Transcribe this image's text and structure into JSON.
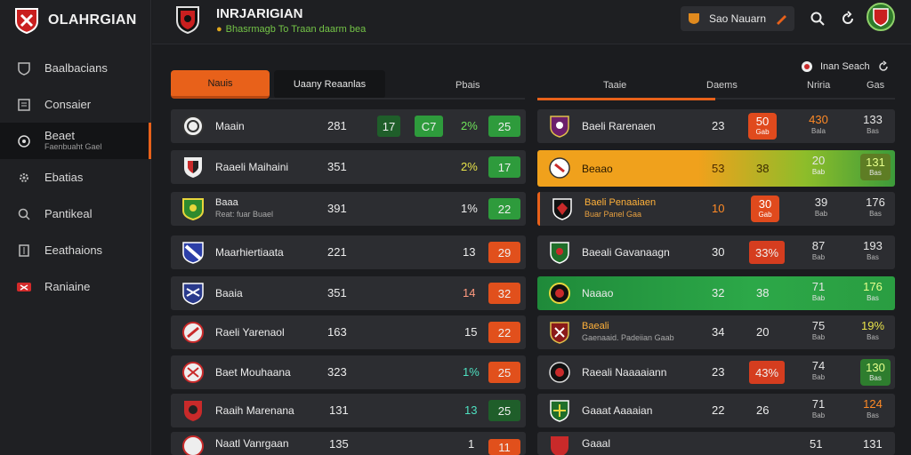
{
  "app": {
    "brand": "OLAHRGIAN",
    "header_title": "INRJARIGIAN",
    "header_subtitle": "Bhasrmagb To Traan daarm bea",
    "user_name": "Sao Nauarn"
  },
  "sidebar": {
    "items": [
      {
        "label": "Baalbacians",
        "sub": "",
        "icon": "shield-icon"
      },
      {
        "label": "Consaier",
        "sub": "",
        "icon": "document-icon"
      },
      {
        "label": "Beaet",
        "sub": "Faenbuaht Gael",
        "icon": "target-icon"
      },
      {
        "label": "Ebatias",
        "sub": "",
        "icon": "gear-icon"
      },
      {
        "label": "Pantikeal",
        "sub": "",
        "icon": "magnify-icon"
      },
      {
        "label": "Eeathaions",
        "sub": "",
        "icon": "list-icon"
      },
      {
        "label": "Raniaine",
        "sub": "",
        "icon": "flag-icon"
      }
    ]
  },
  "tabs": {
    "tab1": "Nauis",
    "tab2": "Uaany Reaanlas",
    "col3": "Pbais"
  },
  "right_headers": {
    "h1": "Taaie",
    "h2": "Daems",
    "h3": "Nriria",
    "h4": "Gas"
  },
  "control": {
    "label": "Inan Seach"
  },
  "left_rows": [
    {
      "name": "Maain",
      "sub": "",
      "c1": "281",
      "c2": "17",
      "c3": "C7",
      "c4": "2%",
      "c5": "25"
    },
    {
      "name": "Raaeli Maihaini",
      "sub": "",
      "c1": "351",
      "c4": "2%",
      "c5": "17"
    },
    {
      "name": "Baaa",
      "sub": "Reat: fuar Buael",
      "c1": "391",
      "c4": "1%",
      "c5": "22"
    },
    {
      "name": "Maarhiertiaata",
      "sub": "",
      "c1": "221",
      "c4": "13",
      "c5": "29"
    },
    {
      "name": "Baaia",
      "sub": "",
      "c1": "351",
      "c4": "14",
      "c5": "32"
    },
    {
      "name": "Raeli Yarenaol",
      "sub": "",
      "c1": "163",
      "c4": "15",
      "c5": "22"
    },
    {
      "name": "Baet Mouhaana",
      "sub": "",
      "c1": "323",
      "c4": "1%",
      "c5": "25"
    },
    {
      "name": "Raaih Marenana",
      "sub": "",
      "c1": "131",
      "c4": "13",
      "c5": "25"
    },
    {
      "name": "Naatl Vanrgaan",
      "sub": "",
      "c1": "135",
      "c4": "1",
      "c5": "11"
    }
  ],
  "right_rows": [
    {
      "name": "Baeli Rarenaen",
      "sub": "",
      "a": "23",
      "b": "50",
      "b_sub": "Gab",
      "c": "430",
      "c_sub": "Bala",
      "d": "133",
      "d_sub": "Bas"
    },
    {
      "name": "Beaao",
      "sub": "",
      "a": "53",
      "b": "38",
      "b_sub": "",
      "c": "20",
      "c_sub": "Bab",
      "d": "131",
      "d_sub": "Bas"
    },
    {
      "name": "Baeli Penaaiaen",
      "sub": "Buar Panel Gaa",
      "a": "10",
      "b": "30",
      "b_sub": "Gab",
      "c": "39",
      "c_sub": "Bab",
      "d": "176",
      "d_sub": "Bas"
    },
    {
      "name": "Baeali Gavanaagn",
      "sub": "",
      "a": "30",
      "b": "33%",
      "b_sub": "",
      "c": "87",
      "c_sub": "Bab",
      "d": "193",
      "d_sub": "Bas"
    },
    {
      "name": "Naaao",
      "sub": "",
      "a": "32",
      "b": "38",
      "b_sub": "",
      "c": "71",
      "c_sub": "Bab",
      "d": "176",
      "d_sub": "Bas"
    },
    {
      "name": "Baeali",
      "sub": "Gaenaaid. Padeiian Gaab",
      "a": "34",
      "b": "20",
      "b_sub": "",
      "c": "75",
      "c_sub": "Bab",
      "d": "19%",
      "d_sub": "Bas"
    },
    {
      "name": "Raeali Naaaaiann",
      "sub": "",
      "a": "23",
      "b": "43%",
      "b_sub": "",
      "c": "74",
      "c_sub": "Bab",
      "d": "130",
      "d_sub": "Bas"
    },
    {
      "name": "Gaaat Aaaaian",
      "sub": "",
      "a": "22",
      "b": "26",
      "b_sub": "",
      "c": "71",
      "c_sub": "Bab",
      "d": "124",
      "d_sub": "Bas"
    },
    {
      "name": "Gaaal",
      "sub": "",
      "a": "",
      "b": "",
      "b_sub": "",
      "c": "51",
      "c_sub": "",
      "d": "131",
      "d_sub": ""
    }
  ],
  "colors": {
    "accent": "#e8611a",
    "green": "#2e9b3c",
    "orange_row": "#f0a11c",
    "bg": "#1b1c1f"
  }
}
